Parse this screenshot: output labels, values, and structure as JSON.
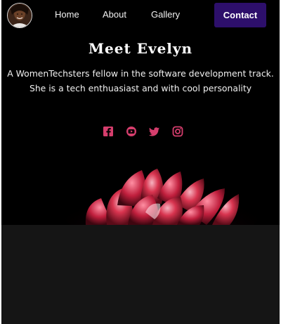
{
  "nav": {
    "avatar_alt": "Evelyn",
    "links": [
      {
        "label": "Home",
        "icon": "none"
      },
      {
        "label": "About",
        "icon": "none"
      },
      {
        "label": "Gallery",
        "icon": "none"
      }
    ],
    "contact_label": "Contact"
  },
  "hero": {
    "title": "Meet Evelyn",
    "line1": "A WomenTechsters fellow in the software development track.",
    "line2": "She is a tech enthuasiast and with cool personality"
  },
  "social": [
    {
      "name": "facebook-icon"
    },
    {
      "name": "youtube-icon"
    },
    {
      "name": "twitter-icon"
    },
    {
      "name": "instagram-icon"
    }
  ],
  "colors": {
    "background": "#000000",
    "accent": "#d63e6d",
    "button": "#2d0f6b",
    "panel": "#151515"
  }
}
